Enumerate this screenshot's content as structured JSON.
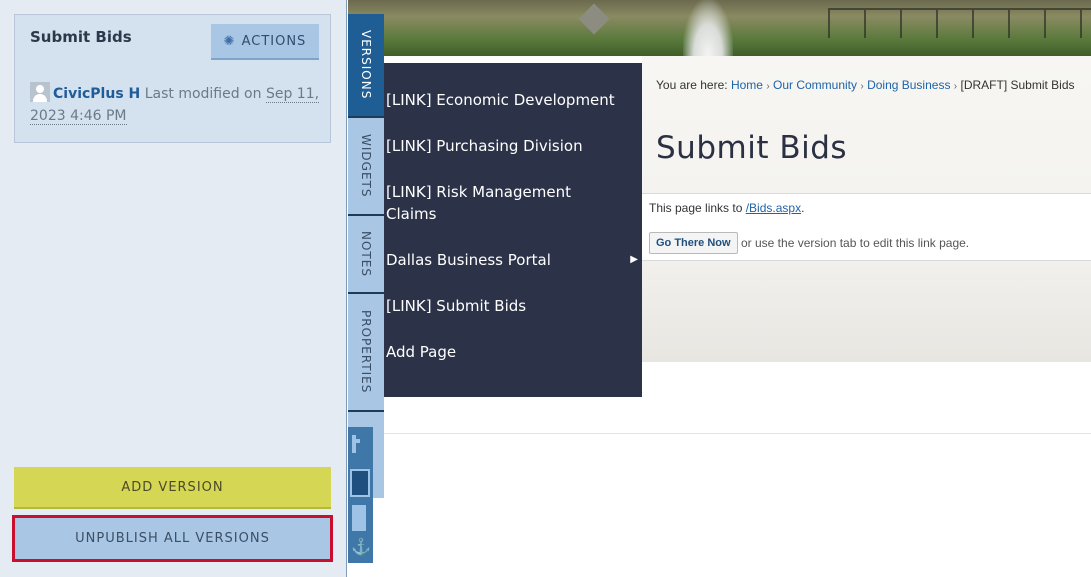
{
  "version_panel": {
    "title": "Submit Bids",
    "actions_label": "ACTIONS",
    "actions_icon": "gear-icon",
    "author": "CivicPlus H",
    "modified_prefix": " Last modified on ",
    "modified_date": "Sep 11, 2023 4:46 PM"
  },
  "buttons": {
    "add_version": "ADD VERSION",
    "unpublish_all": "UNPUBLISH ALL VERSIONS"
  },
  "tabs": [
    {
      "label": "VERSIONS",
      "active": true
    },
    {
      "label": "WIDGETS",
      "active": false
    },
    {
      "label": "NOTES",
      "active": false
    },
    {
      "label": "PROPERTIES",
      "active": false
    }
  ],
  "menu": {
    "items": [
      {
        "label": "[LINK] Economic Development"
      },
      {
        "label": "[LINK] Purchasing Division"
      },
      {
        "label": "[LINK] Risk Management Claims"
      },
      {
        "label": "Dallas Business Portal",
        "submenu_arrow": "▶"
      },
      {
        "label": "[LINK] Submit Bids"
      },
      {
        "label": "Add Page"
      }
    ]
  },
  "breadcrumb": {
    "prefix": "You are here: ",
    "items": [
      "Home",
      "Our Community",
      "Doing Business"
    ],
    "separator": "›",
    "current": "[DRAFT] Submit Bids"
  },
  "page": {
    "title": "Submit Bids",
    "link_prefix": "This page links to ",
    "link_target": "/Bids.aspx",
    "link_suffix": ".",
    "go_button": "Go There Now",
    "go_hint": "or use the version tab to edit this link page."
  },
  "colors": {
    "accent_blue": "#a9c6e4",
    "active_tab": "#1f5e94",
    "menu_bg": "#2c3349",
    "add_version_bg": "#d5d653",
    "highlight_border": "#c8102e"
  }
}
